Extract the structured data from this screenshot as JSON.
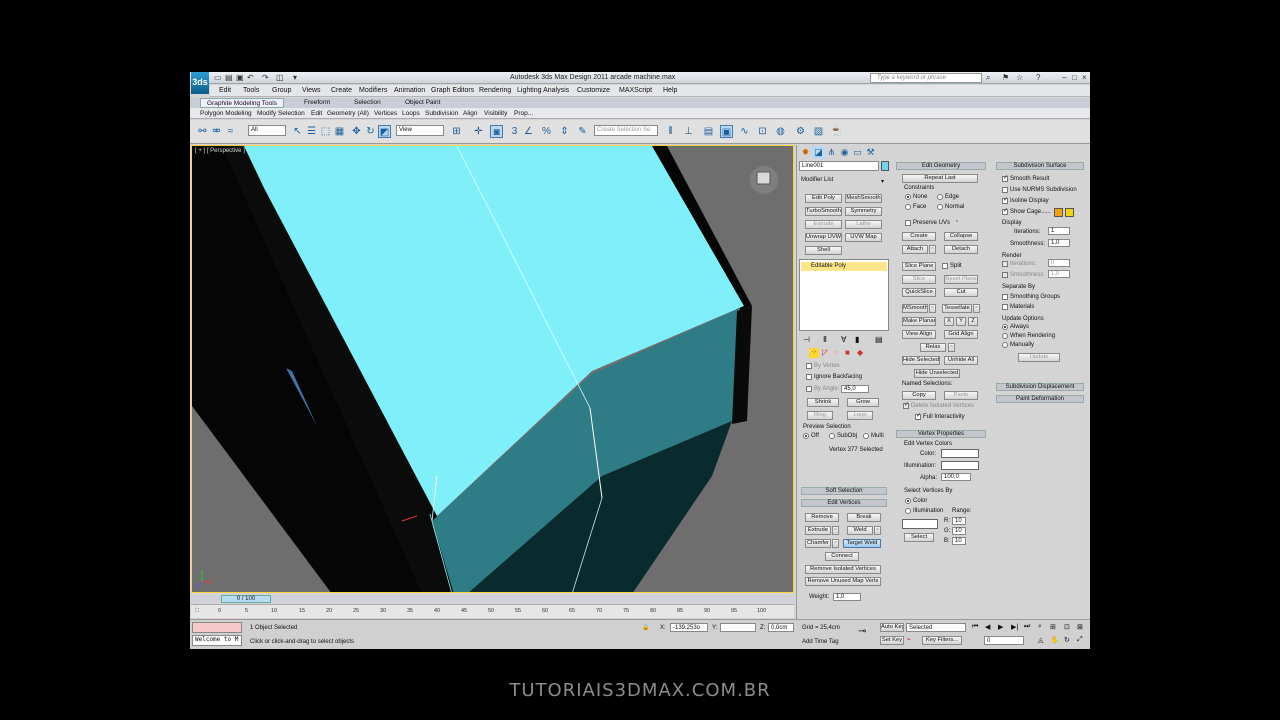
{
  "window": {
    "title": "Autodesk 3ds Max Design 2011     arcade machine.max",
    "search_placeholder": "Type a keyword or phrase",
    "logo_text": "3ds"
  },
  "menu": [
    "Edit",
    "Tools",
    "Group",
    "Views",
    "Create",
    "Modifiers",
    "Animation",
    "Graph Editors",
    "Rendering",
    "Lighting Analysis",
    "Customize",
    "MAXScript",
    "Help"
  ],
  "ribbon": {
    "tabs": [
      "Graphite Modeling Tools",
      "Freeform",
      "Selection",
      "Object Paint"
    ],
    "subtabs": [
      "Polygon Modeling",
      "Modify Selection",
      "Edit",
      "Geometry (All)",
      "Vertices",
      "Loops",
      "Subdivision",
      "Align",
      "Visibility",
      "Prop..."
    ]
  },
  "toolbar": {
    "filter_value": "All",
    "refcoord_value": "View",
    "selection_set_placeholder": "Create Selection Se"
  },
  "viewport": {
    "label": "[ + ] [ Perspective ]",
    "face_color": "#7ff0fa",
    "side_color": "#2e7c85"
  },
  "timeline": {
    "frame_counter": "0 / 100",
    "ticks": [
      "0",
      "5",
      "10",
      "15",
      "20",
      "25",
      "30",
      "35",
      "40",
      "45",
      "50",
      "55",
      "60",
      "65",
      "70",
      "75",
      "80",
      "85",
      "90",
      "95",
      "100"
    ]
  },
  "status": {
    "maxscript": "Welcome to M",
    "objects_selected": "1 Object Selected",
    "prompt": "Click or click-and-drag to select objects",
    "x_value": "-139,253o",
    "y_value": "",
    "z_value": "0,0cm",
    "grid": "Grid = 25,4cm",
    "add_time_tag": "Add Time Tag",
    "auto_key": "Auto Key",
    "set_key": "Set Key",
    "selected": "Selected",
    "key_filters": "Key Filters...",
    "frame": "0"
  },
  "command_panel": {
    "object_name": "Line001",
    "object_color": "#6fd4f2",
    "modifier_list": "Modifier List",
    "modifier_buttons": [
      "Edit Poly",
      "MeshSmooth",
      "TurboSmooth",
      "Symmetry",
      "Extrude",
      "Lathe",
      "Unwrap UVW",
      "UVW Map",
      "Shell"
    ],
    "stack_item": "Editable Poly",
    "selection": {
      "by_vertex": "By Vertex",
      "ignore_backfacing": "Ignore Backfacing",
      "by_angle": "By Angle:",
      "angle_value": "45,0",
      "shrink": "Shrink",
      "grow": "Grow",
      "ring": "Ring",
      "loop": "Loop",
      "preview_selection": "Preview Selection",
      "off": "Off",
      "subobj": "SubObj",
      "multi": "Multi",
      "status": "Vertex 377 Selected"
    },
    "soft_selection": "Soft Selection",
    "edit_vertices": {
      "title": "Edit Vertices",
      "remove": "Remove",
      "break": "Break",
      "extrude": "Extrude",
      "weld": "Weld",
      "chamfer": "Chamfer",
      "target_weld": "Target Weld",
      "connect": "Connect",
      "remove_isolated": "Remove Isolated Vertices",
      "remove_unused": "Remove Unused Map Verts",
      "weight_label": "Weight:",
      "weight_value": "1,0"
    }
  },
  "edit_geometry": {
    "title": "Edit Geometry",
    "repeat_last": "Repeat Last",
    "constraints": "Constraints",
    "none": "None",
    "edge": "Edge",
    "face": "Face",
    "normal": "Normal",
    "preserve_uvs": "Preserve UVs",
    "create": "Create",
    "collapse": "Collapse",
    "attach": "Attach",
    "detach": "Detach",
    "slice_plane": "Slice Plane",
    "split": "Split",
    "slice": "Slice",
    "reset_plane": "Reset Plane",
    "quickslice": "QuickSlice",
    "cut": "Cut",
    "msmooth": "MSmooth",
    "tessellate": "Tessellate",
    "make_planar": "Make Planar",
    "x": "X",
    "y": "Y",
    "z": "Z",
    "view_align": "View Align",
    "grid_align": "Grid Align",
    "relax": "Relax",
    "hide_selected": "Hide Selected",
    "unhide_all": "Unhide All",
    "hide_unselected": "Hide Unselected",
    "named_selections": "Named Selections:",
    "copy": "Copy",
    "paste": "Paste",
    "delete_isolated": "Delete Isolated Vertices",
    "full_interactivity": "Full Interactivity"
  },
  "vertex_properties": {
    "title": "Vertex Properties",
    "edit_vertex_colors": "Edit Vertex Colors",
    "color": "Color:",
    "illumination": "Illumination:",
    "alpha": "Alpha:",
    "alpha_value": "100,0",
    "select_by": "Select Vertices By",
    "by_color": "Color",
    "by_illumination": "Illumination",
    "range": "Range:",
    "r": "R:",
    "g": "G:",
    "b": "B:",
    "r_value": "10",
    "g_value": "10",
    "b_value": "10",
    "select": "Select"
  },
  "subdivision_surface": {
    "title": "Subdivision Surface",
    "smooth_result": "Smooth Result",
    "use_nurms": "Use NURMS Subdivision",
    "isoline_display": "Isoline Display",
    "show_cage": "Show Cage......",
    "cage_color_1": "#f5a012",
    "cage_color_2": "#f5d012",
    "display": "Display",
    "iterations": "Iterations:",
    "iterations_value": "1",
    "smoothness": "Smoothness:",
    "smoothness_value": "1,0",
    "render": "Render",
    "separate_by": "Separate By",
    "smoothing_groups": "Smoothing Groups",
    "materials": "Materials",
    "update_options": "Update Options",
    "always": "Always",
    "when_rendering": "When Rendering",
    "manually": "Manually",
    "update": "Update",
    "subdivision_displacement": "Subdivision Displacement",
    "paint_deformation": "Paint Deformation"
  },
  "watermark": "TUTORIAIS3DMAX.COM.BR"
}
